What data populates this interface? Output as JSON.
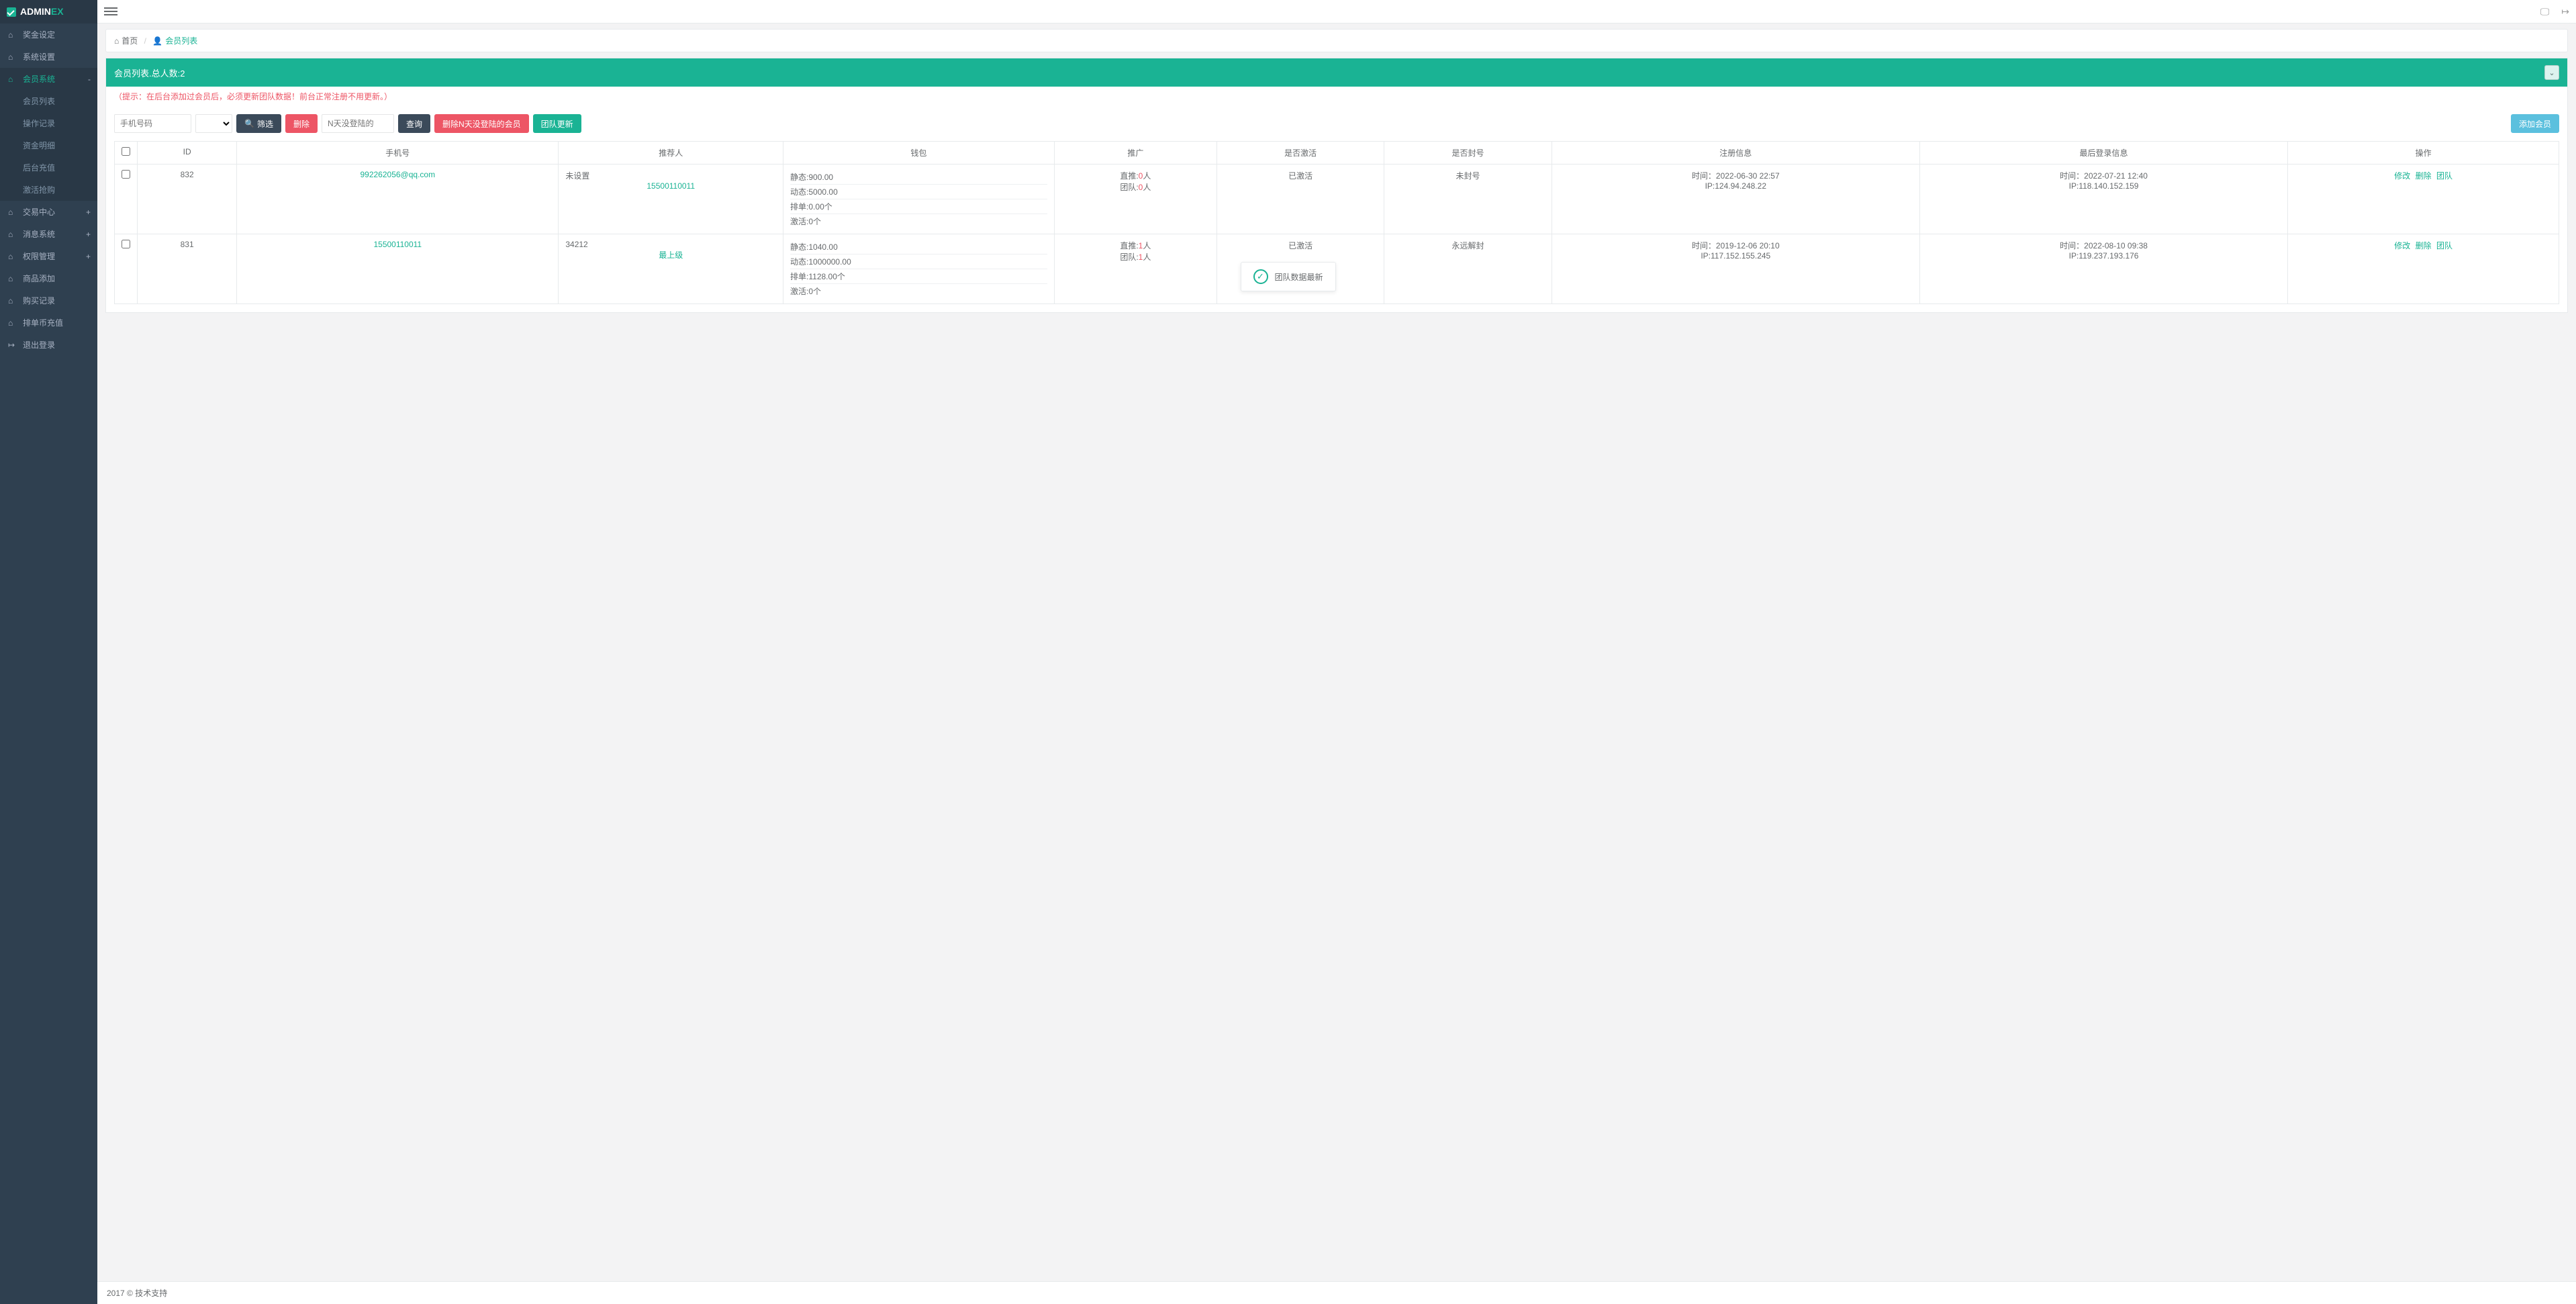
{
  "brand": {
    "a": "ADMIN",
    "b": "EX"
  },
  "sidebar": {
    "items": [
      {
        "label": "奖金设定",
        "expand": ""
      },
      {
        "label": "系统设置",
        "expand": ""
      },
      {
        "label": "会员系统",
        "expand": "-",
        "active": true,
        "sub": [
          {
            "label": "会员列表"
          },
          {
            "label": "操作记录"
          },
          {
            "label": "资金明细"
          },
          {
            "label": "后台充值"
          },
          {
            "label": "激活抢购"
          }
        ]
      },
      {
        "label": "交易中心",
        "expand": "+"
      },
      {
        "label": "消息系统",
        "expand": "+"
      },
      {
        "label": "权限管理",
        "expand": "+"
      },
      {
        "label": "商品添加",
        "expand": ""
      },
      {
        "label": "购买记录",
        "expand": ""
      },
      {
        "label": "排单币充值",
        "expand": ""
      },
      {
        "label": "退出登录",
        "expand": "",
        "logout": true
      }
    ]
  },
  "breadcrumb": {
    "home": "首页",
    "current": "会员列表"
  },
  "panel": {
    "title_prefix": "会员列表.总人数:",
    "total": "2",
    "hint": "（提示：在后台添加过会员后，必须更新团队数据！前台正常注册不用更新。）"
  },
  "toolbar": {
    "phone_placeholder": "手机号码",
    "filter": "筛选",
    "delete": "删除",
    "days_placeholder": "N天没登陆的",
    "query": "查询",
    "delete_inactive": "删除N天没登陆的会员",
    "team_update": "团队更新",
    "add_member": "添加会员"
  },
  "table": {
    "headers": [
      "ID",
      "手机号",
      "推荐人",
      "钱包",
      "推广",
      "是否激活",
      "是否封号",
      "注册信息",
      "最后登录信息",
      "操作"
    ],
    "wallet_labels": {
      "static": "静态:",
      "dynamic": "动态:",
      "paidan": "排单:",
      "activate": "激活:"
    },
    "promo_labels": {
      "direct": "直推:",
      "team": "团队:",
      "unit": "人"
    },
    "reg_labels": {
      "time": "时间：",
      "ip": "IP:"
    },
    "action_labels": {
      "edit": "修改",
      "del": "删除",
      "team": "团队"
    },
    "rows": [
      {
        "id": "832",
        "phone": "992262056@qq.com",
        "referrer": "15500110011",
        "referrer_note": "未设置",
        "wallet": {
          "static": "900.00",
          "dynamic": "5000.00",
          "paidan": "0.00个",
          "activate": "0个"
        },
        "promo": {
          "direct": "0",
          "team": "0",
          "color": "pink"
        },
        "activated": "已激活",
        "blocked": "未封号",
        "reg": {
          "time": "2022-06-30 22:57",
          "ip": "124.94.248.22"
        },
        "last": {
          "time": "2022-07-21 12:40",
          "ip": "118.140.152.159"
        }
      },
      {
        "id": "831",
        "phone": "15500110011",
        "referrer": "最上级",
        "referrer_note": "34212",
        "wallet": {
          "static": "1040.00",
          "dynamic": "1000000.00",
          "paidan": "1128.00个",
          "activate": "0个"
        },
        "promo": {
          "direct": "1",
          "team": "1",
          "color": "pink"
        },
        "activated": "已激活",
        "blocked": "永远解封",
        "reg": {
          "time": "2019-12-06 20:10",
          "ip": "117.152.155.245"
        },
        "last": {
          "time": "2022-08-10 09:38",
          "ip": "119.237.193.176"
        }
      }
    ]
  },
  "toast": "团队数据最新",
  "footer": "2017 © 技术支持"
}
